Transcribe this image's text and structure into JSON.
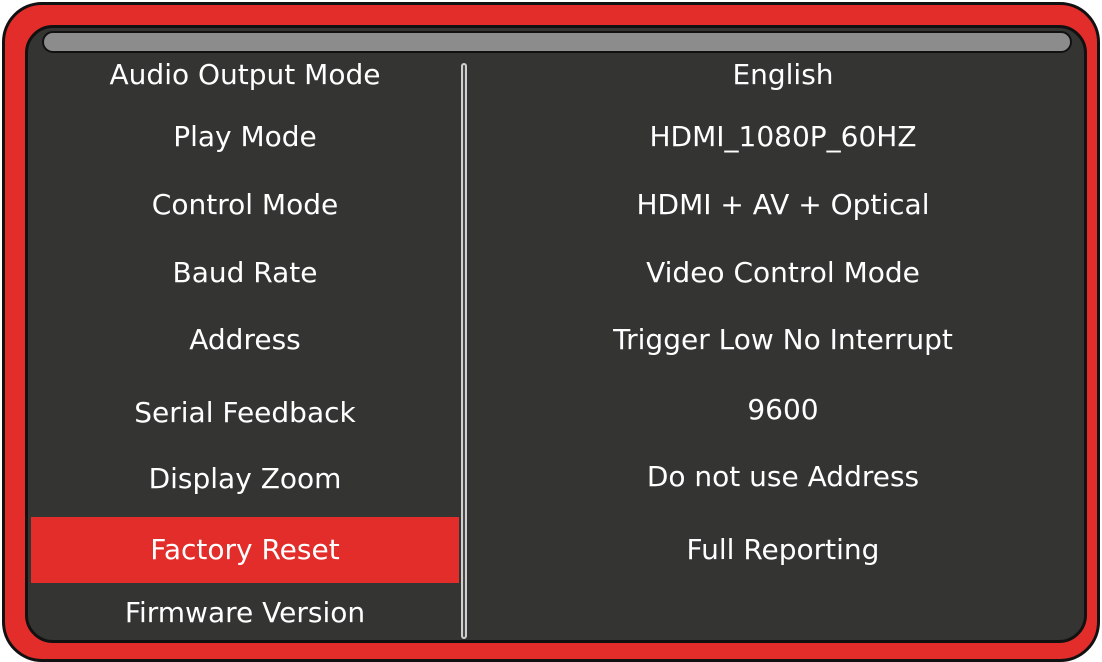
{
  "menu": {
    "items": [
      {
        "label": "Audio Output Mode"
      },
      {
        "label": "Play Mode"
      },
      {
        "label": "Control Mode"
      },
      {
        "label": "Baud Rate"
      },
      {
        "label": "Address"
      },
      {
        "label": "Serial Feedback"
      },
      {
        "label": "Display Zoom"
      },
      {
        "label": "Factory Reset",
        "selected": true
      },
      {
        "label": "Firmware Version"
      }
    ]
  },
  "values": [
    "English",
    "HDMI_1080P_60HZ",
    "HDMI + AV + Optical",
    "Video Control Mode",
    "Trigger Low No Interrupt",
    "9600",
    "Do not use Address",
    "Full Reporting"
  ],
  "colors": {
    "frame": "#e32d2a",
    "screen": "#343433",
    "selected": "#e32d2a",
    "text": "#ffffff"
  }
}
